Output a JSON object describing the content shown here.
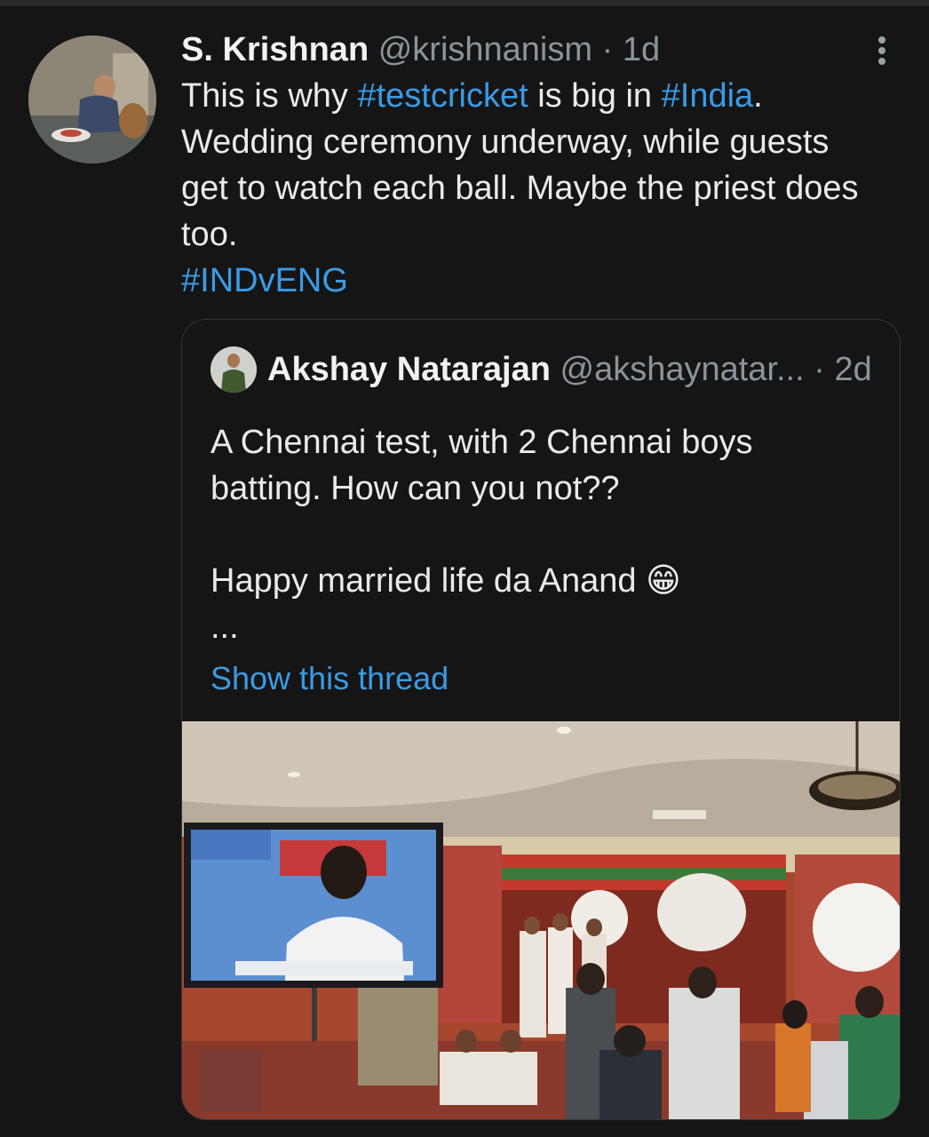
{
  "tweet": {
    "name": "S. Krishnan",
    "handle": "@krishnanism",
    "separator": "·",
    "time": "1d",
    "text_lines": [
      {
        "parts": [
          {
            "t": "This is why "
          },
          {
            "t": "#testcricket",
            "link": true
          },
          {
            "t": " is big in "
          },
          {
            "t": "#India",
            "link": true
          },
          {
            "t": "."
          }
        ]
      },
      {
        "parts": [
          {
            "t": "Wedding ceremony underway, while guests"
          }
        ]
      },
      {
        "parts": [
          {
            "t": "get to watch each ball. Maybe the priest does"
          }
        ]
      },
      {
        "parts": [
          {
            "t": "too."
          }
        ]
      },
      {
        "parts": [
          {
            "t": "#INDvENG",
            "link": true
          }
        ]
      }
    ]
  },
  "quoted": {
    "name": "Akshay Natarajan",
    "handle": "@akshaynatar...",
    "separator": "·",
    "time": "2d",
    "lines": [
      "A Chennai test, with 2 Chennai boys",
      "batting. How can you not??",
      "",
      "Happy married life da Anand 😁",
      "..."
    ],
    "show_thread": "Show this thread"
  },
  "icons": {
    "more": "more-vertical-icon"
  },
  "colors": {
    "link": "#3a9be5",
    "background": "#151515",
    "muted": "#8b949a"
  }
}
